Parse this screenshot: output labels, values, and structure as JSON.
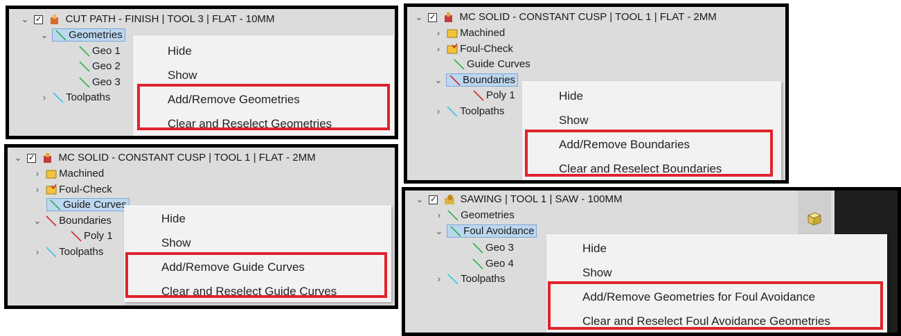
{
  "panel1": {
    "header": "CUT PATH - FINISH | TOOL 3 | FLAT - 10MM",
    "items": [
      "Geometries",
      "Geo 1",
      "Geo 2",
      "Geo 3",
      "Toolpaths"
    ],
    "menu": [
      "Hide",
      "Show",
      "Add/Remove Geometries",
      "Clear and Reselect Geometries"
    ]
  },
  "panel2": {
    "header": "MC SOLID - CONSTANT CUSP | TOOL 1 | FLAT - 2MM",
    "items": [
      "Machined",
      "Foul-Check",
      "Guide Curves",
      "Boundaries",
      "Poly 1",
      "Toolpaths"
    ],
    "menu": [
      "Hide",
      "Show",
      "Add/Remove Boundaries",
      "Clear and Reselect Boundaries"
    ]
  },
  "panel3": {
    "header": "MC SOLID - CONSTANT CUSP | TOOL 1 | FLAT - 2MM",
    "items": [
      "Machined",
      "Foul-Check",
      "Guide Curves",
      "Boundaries",
      "Poly 1",
      "Toolpaths"
    ],
    "menu": [
      "Hide",
      "Show",
      "Add/Remove Guide Curves",
      "Clear and Reselect Guide Curves"
    ]
  },
  "panel4": {
    "header": "SAWING | TOOL 1 | SAW - 100MM",
    "items": [
      "Geometries",
      "Foul Avoidance",
      "Geo 3",
      "Geo 4",
      "Toolpaths"
    ],
    "menu": [
      "Hide",
      "Show",
      "Add/Remove Geometries for Foul Avoidance",
      "Clear and Reselect Foul Avoidance Geometries"
    ]
  },
  "colors": {
    "highlight": "#e0242c",
    "selection": "#bcd7ef",
    "geo_green": "#2bb34a",
    "boundary_red": "#d12a2a",
    "toolpath_cyan": "#35c6e6"
  },
  "icons": [
    "chevron-down-icon",
    "chevron-right-icon",
    "checkbox-icon",
    "operation-icon",
    "green-curve-icon",
    "red-curve-icon",
    "cyan-curve-icon",
    "machined-icon",
    "foul-check-icon",
    "cube-icon"
  ]
}
